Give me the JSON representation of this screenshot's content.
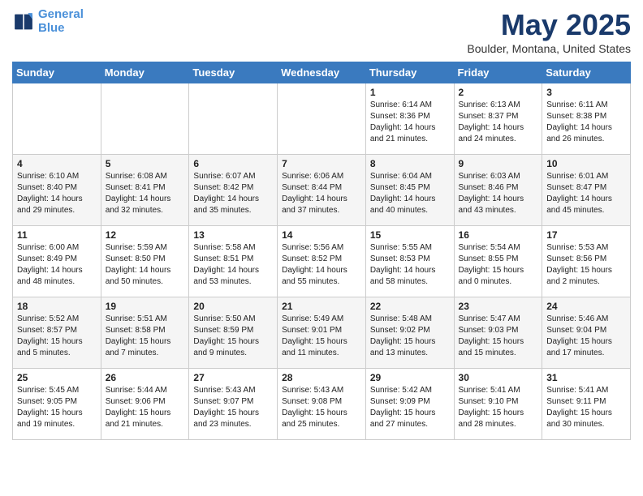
{
  "header": {
    "logo_line1": "General",
    "logo_line2": "Blue",
    "title": "May 2025",
    "subtitle": "Boulder, Montana, United States"
  },
  "calendar": {
    "days_of_week": [
      "Sunday",
      "Monday",
      "Tuesday",
      "Wednesday",
      "Thursday",
      "Friday",
      "Saturday"
    ],
    "weeks": [
      [
        {
          "day": "",
          "info": ""
        },
        {
          "day": "",
          "info": ""
        },
        {
          "day": "",
          "info": ""
        },
        {
          "day": "",
          "info": ""
        },
        {
          "day": "1",
          "info": "Sunrise: 6:14 AM\nSunset: 8:36 PM\nDaylight: 14 hours\nand 21 minutes."
        },
        {
          "day": "2",
          "info": "Sunrise: 6:13 AM\nSunset: 8:37 PM\nDaylight: 14 hours\nand 24 minutes."
        },
        {
          "day": "3",
          "info": "Sunrise: 6:11 AM\nSunset: 8:38 PM\nDaylight: 14 hours\nand 26 minutes."
        }
      ],
      [
        {
          "day": "4",
          "info": "Sunrise: 6:10 AM\nSunset: 8:40 PM\nDaylight: 14 hours\nand 29 minutes."
        },
        {
          "day": "5",
          "info": "Sunrise: 6:08 AM\nSunset: 8:41 PM\nDaylight: 14 hours\nand 32 minutes."
        },
        {
          "day": "6",
          "info": "Sunrise: 6:07 AM\nSunset: 8:42 PM\nDaylight: 14 hours\nand 35 minutes."
        },
        {
          "day": "7",
          "info": "Sunrise: 6:06 AM\nSunset: 8:44 PM\nDaylight: 14 hours\nand 37 minutes."
        },
        {
          "day": "8",
          "info": "Sunrise: 6:04 AM\nSunset: 8:45 PM\nDaylight: 14 hours\nand 40 minutes."
        },
        {
          "day": "9",
          "info": "Sunrise: 6:03 AM\nSunset: 8:46 PM\nDaylight: 14 hours\nand 43 minutes."
        },
        {
          "day": "10",
          "info": "Sunrise: 6:01 AM\nSunset: 8:47 PM\nDaylight: 14 hours\nand 45 minutes."
        }
      ],
      [
        {
          "day": "11",
          "info": "Sunrise: 6:00 AM\nSunset: 8:49 PM\nDaylight: 14 hours\nand 48 minutes."
        },
        {
          "day": "12",
          "info": "Sunrise: 5:59 AM\nSunset: 8:50 PM\nDaylight: 14 hours\nand 50 minutes."
        },
        {
          "day": "13",
          "info": "Sunrise: 5:58 AM\nSunset: 8:51 PM\nDaylight: 14 hours\nand 53 minutes."
        },
        {
          "day": "14",
          "info": "Sunrise: 5:56 AM\nSunset: 8:52 PM\nDaylight: 14 hours\nand 55 minutes."
        },
        {
          "day": "15",
          "info": "Sunrise: 5:55 AM\nSunset: 8:53 PM\nDaylight: 14 hours\nand 58 minutes."
        },
        {
          "day": "16",
          "info": "Sunrise: 5:54 AM\nSunset: 8:55 PM\nDaylight: 15 hours\nand 0 minutes."
        },
        {
          "day": "17",
          "info": "Sunrise: 5:53 AM\nSunset: 8:56 PM\nDaylight: 15 hours\nand 2 minutes."
        }
      ],
      [
        {
          "day": "18",
          "info": "Sunrise: 5:52 AM\nSunset: 8:57 PM\nDaylight: 15 hours\nand 5 minutes."
        },
        {
          "day": "19",
          "info": "Sunrise: 5:51 AM\nSunset: 8:58 PM\nDaylight: 15 hours\nand 7 minutes."
        },
        {
          "day": "20",
          "info": "Sunrise: 5:50 AM\nSunset: 8:59 PM\nDaylight: 15 hours\nand 9 minutes."
        },
        {
          "day": "21",
          "info": "Sunrise: 5:49 AM\nSunset: 9:01 PM\nDaylight: 15 hours\nand 11 minutes."
        },
        {
          "day": "22",
          "info": "Sunrise: 5:48 AM\nSunset: 9:02 PM\nDaylight: 15 hours\nand 13 minutes."
        },
        {
          "day": "23",
          "info": "Sunrise: 5:47 AM\nSunset: 9:03 PM\nDaylight: 15 hours\nand 15 minutes."
        },
        {
          "day": "24",
          "info": "Sunrise: 5:46 AM\nSunset: 9:04 PM\nDaylight: 15 hours\nand 17 minutes."
        }
      ],
      [
        {
          "day": "25",
          "info": "Sunrise: 5:45 AM\nSunset: 9:05 PM\nDaylight: 15 hours\nand 19 minutes."
        },
        {
          "day": "26",
          "info": "Sunrise: 5:44 AM\nSunset: 9:06 PM\nDaylight: 15 hours\nand 21 minutes."
        },
        {
          "day": "27",
          "info": "Sunrise: 5:43 AM\nSunset: 9:07 PM\nDaylight: 15 hours\nand 23 minutes."
        },
        {
          "day": "28",
          "info": "Sunrise: 5:43 AM\nSunset: 9:08 PM\nDaylight: 15 hours\nand 25 minutes."
        },
        {
          "day": "29",
          "info": "Sunrise: 5:42 AM\nSunset: 9:09 PM\nDaylight: 15 hours\nand 27 minutes."
        },
        {
          "day": "30",
          "info": "Sunrise: 5:41 AM\nSunset: 9:10 PM\nDaylight: 15 hours\nand 28 minutes."
        },
        {
          "day": "31",
          "info": "Sunrise: 5:41 AM\nSunset: 9:11 PM\nDaylight: 15 hours\nand 30 minutes."
        }
      ]
    ]
  }
}
